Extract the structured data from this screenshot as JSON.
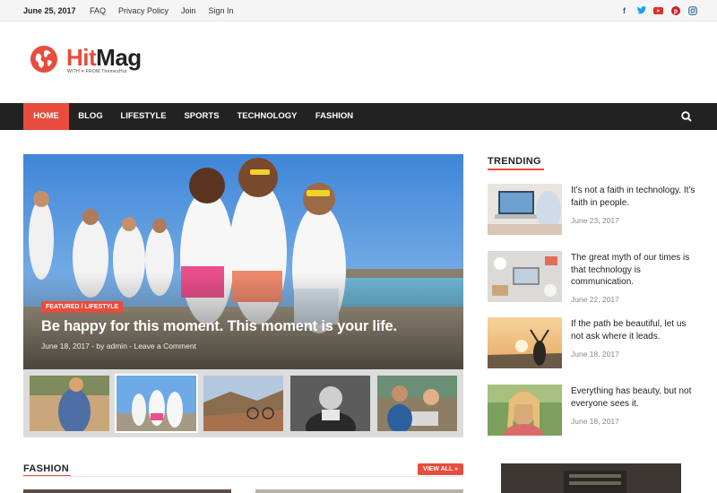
{
  "topbar": {
    "date": "June 25, 2017",
    "links": [
      "FAQ",
      "Privacy Policy",
      "Join",
      "Sign In"
    ],
    "social": [
      {
        "icon": "facebook-icon",
        "glyph": "f",
        "color": "#3b5998"
      },
      {
        "icon": "twitter-icon",
        "glyph": "t",
        "color": "#1da1f2"
      },
      {
        "icon": "youtube-icon",
        "glyph": "▶",
        "color": "#e52d27"
      },
      {
        "icon": "pinterest-icon",
        "glyph": "p",
        "color": "#cb2027"
      },
      {
        "icon": "instagram-icon",
        "glyph": "◎",
        "color": "#3f729b"
      }
    ]
  },
  "brand": {
    "name_part1": "Hit",
    "name_part2": "Mag",
    "tagline_prefix": "WITH",
    "tagline_suffix": "FROM ThemezHut",
    "accent_color": "#e74c3c"
  },
  "nav": {
    "items": [
      "HOME",
      "BLOG",
      "LIFESTYLE",
      "SPORTS",
      "TECHNOLOGY",
      "FASHION"
    ],
    "active": "HOME"
  },
  "featured": {
    "category": "FEATURED / LIFESTYLE",
    "title": "Be happy for this moment. This moment is your life.",
    "meta": "June 18, 2017 - by admin - Leave a Comment"
  },
  "trending": {
    "heading": "TRENDING",
    "posts": [
      {
        "title": "It’s not a faith in technology. It’s faith in people.",
        "date": "June 23, 2017"
      },
      {
        "title": "The great myth of our times is that technology is communication.",
        "date": "June 22, 2017"
      },
      {
        "title": "If the path be beautiful, let us not ask where it leads.",
        "date": "June 18, 2017"
      },
      {
        "title": "Everything has beauty, but not everyone sees it.",
        "date": "June 18, 2017"
      }
    ]
  },
  "fashion": {
    "heading": "FASHION",
    "view_all": "VIEW ALL »"
  }
}
